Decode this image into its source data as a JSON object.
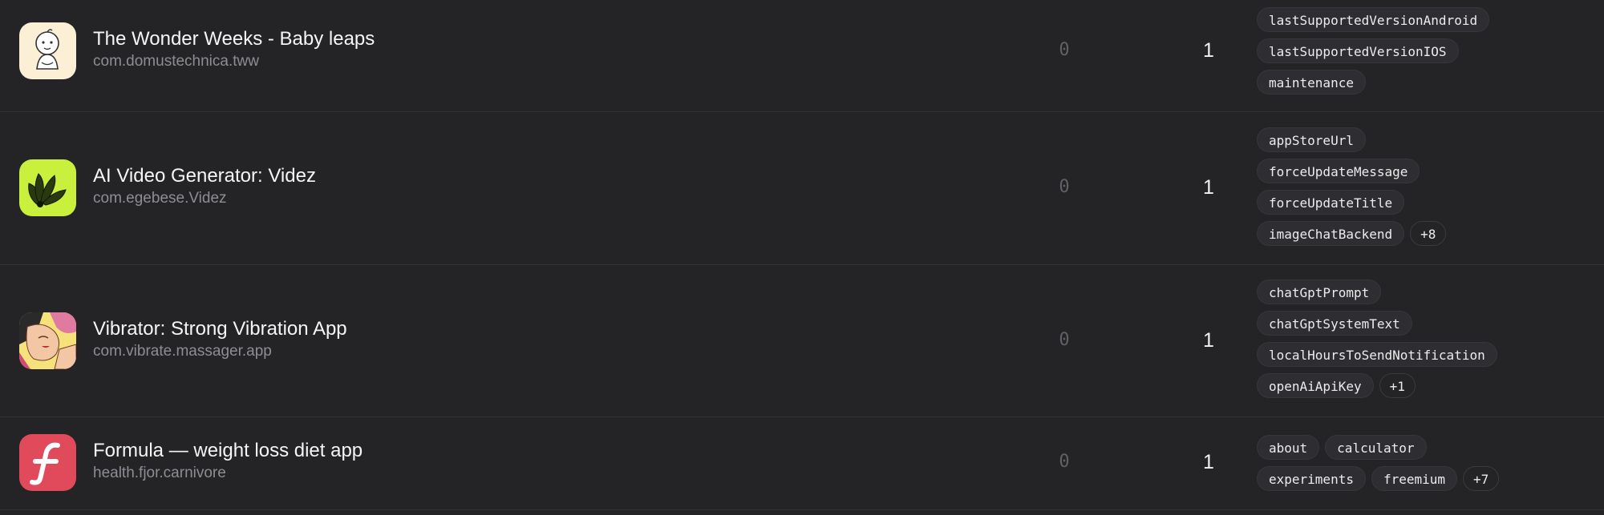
{
  "apps": [
    {
      "name": "The Wonder Weeks - Baby leaps",
      "bundle_id": "com.domustechnica.tww",
      "icon": "baby-icon",
      "count_a": "0",
      "count_b": "1",
      "tags": [
        "lastSupportedVersionAndroid",
        "lastSupportedVersionIOS",
        "maintenance"
      ]
    },
    {
      "name": "AI Video Generator: Videz",
      "bundle_id": "com.egebese.Videz",
      "icon": "petals-icon",
      "count_a": "0",
      "count_b": "1",
      "tags": [
        "appStoreUrl",
        "forceUpdateMessage",
        "forceUpdateTitle",
        "imageChatBackend"
      ],
      "more": "+8"
    },
    {
      "name": "Vibrator: Strong Vibration App",
      "bundle_id": "com.vibrate.massager.app",
      "icon": "pinup-illustration-icon",
      "count_a": "0",
      "count_b": "1",
      "tags": [
        "chatGptPrompt",
        "chatGptSystemText",
        "localHoursToSendNotification",
        "openAiApiKey"
      ],
      "more": "+1"
    },
    {
      "name": "Formula — weight loss diet app",
      "bundle_id": "health.fjor.carnivore",
      "icon": "formula-f-icon",
      "count_a": "0",
      "count_b": "1",
      "tags": [
        "about",
        "calculator",
        "experiments",
        "freemium"
      ],
      "more": "+7"
    }
  ],
  "colors": {
    "background": "#242427",
    "row_divider": "#343438",
    "muted_text": "#8d8d93",
    "tag_background": "#2e2e32",
    "formula_red": "#e04a5b",
    "videz_lime": "#c8f03c"
  }
}
